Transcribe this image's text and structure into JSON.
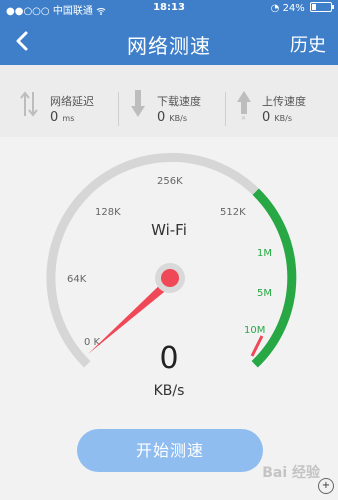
{
  "status_bar": {
    "signal": "●●○○○",
    "carrier": "中国联通",
    "time": "18:13",
    "battery_pct": "24%"
  },
  "header": {
    "title": "网络测速",
    "history_label": "历史",
    "back_icon": "chevron-left-icon"
  },
  "metrics": [
    {
      "label": "网络延迟",
      "value": "0",
      "unit": "ms",
      "icon": "latency-arrows-icon"
    },
    {
      "label": "下载速度",
      "value": "0",
      "unit": "KB/s",
      "icon": "download-arrow-icon"
    },
    {
      "label": "上传速度",
      "value": "0",
      "unit": "KB/s",
      "icon": "upload-arrow-icon"
    }
  ],
  "gauge": {
    "connection": "Wi-Fi",
    "speed_value": "0",
    "speed_unit": "KB/s",
    "ticks": [
      "0 K",
      "64K",
      "128K",
      "256K",
      "512K",
      "1M",
      "5M",
      "10M"
    ],
    "needle_value": "0 K",
    "colors": {
      "track": "#d6d6d6",
      "green": "#27a844",
      "needle": "#ef4856",
      "accent": "#3f7fca"
    }
  },
  "actions": {
    "start_label": "开始测速"
  },
  "watermark": {
    "text": "Bai 经验"
  }
}
